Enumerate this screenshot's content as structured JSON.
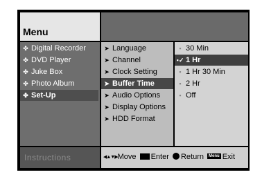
{
  "title": "Menu",
  "main_menu": [
    {
      "label": "Digital Recorder",
      "icon": "✤"
    },
    {
      "label": "DVD Player",
      "icon": "✤"
    },
    {
      "label": "Juke Box",
      "icon": "✤"
    },
    {
      "label": "Photo Album",
      "icon": "✤"
    },
    {
      "label": "Set-Up",
      "icon": "✤",
      "selected": true
    }
  ],
  "setup_menu": [
    {
      "label": "Language",
      "icon": "➤"
    },
    {
      "label": "Channel",
      "icon": "➤"
    },
    {
      "label": "Clock Setting",
      "icon": "➤"
    },
    {
      "label": "Buffer Time",
      "icon": "➤",
      "selected": true
    },
    {
      "label": "Audio Options",
      "icon": "➤"
    },
    {
      "label": "Display Options",
      "icon": "➤"
    },
    {
      "label": "HDD Format",
      "icon": "➤"
    }
  ],
  "buffer_options": [
    {
      "label": "30 Min",
      "icon": "▪"
    },
    {
      "label": "1 Hr",
      "icon": "▪✓",
      "selected": true
    },
    {
      "label": "1 Hr 30 Min",
      "icon": "▪"
    },
    {
      "label": "2 Hr",
      "icon": "▪"
    },
    {
      "label": "Off",
      "icon": "▪"
    }
  ],
  "footer": {
    "instructions": "Instructions",
    "move_icon": "◀▲▼▶",
    "move": "Move",
    "enter": "Enter",
    "return": "Return",
    "menu_key": "Menu",
    "exit": "Exit"
  }
}
